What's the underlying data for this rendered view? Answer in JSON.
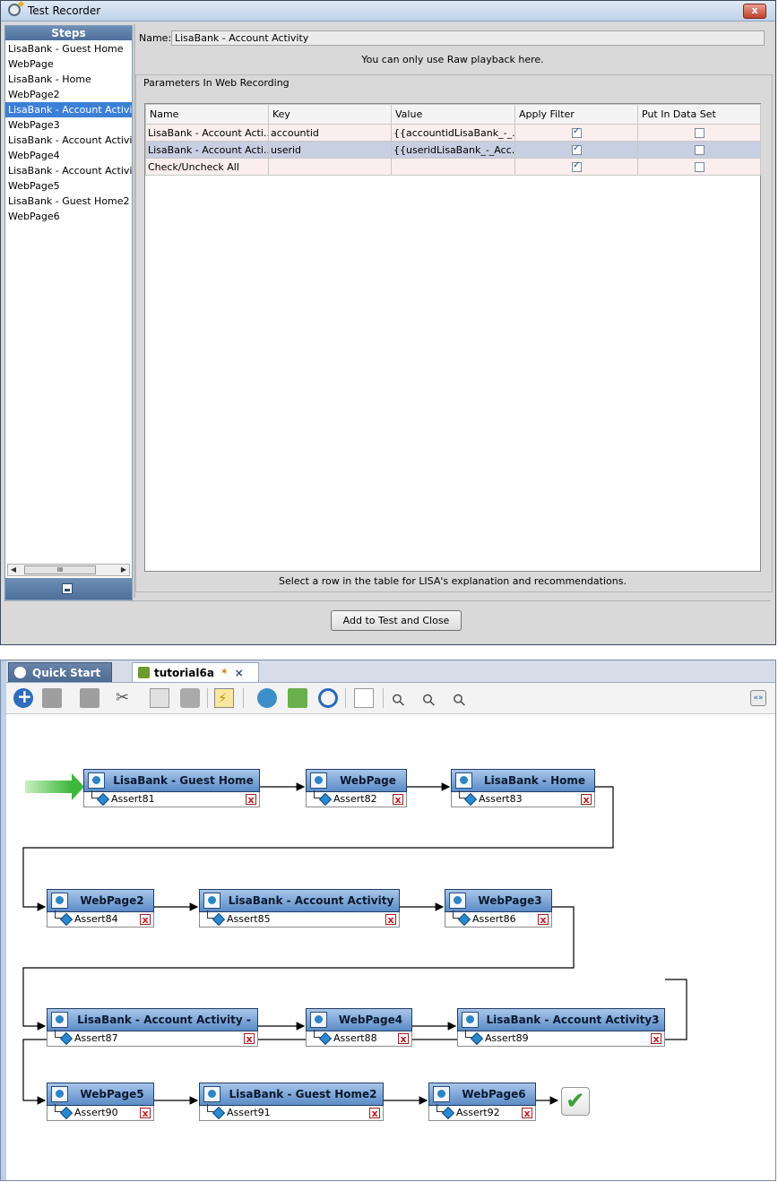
{
  "recorder": {
    "title": "Test Recorder",
    "steps_header": "Steps",
    "steps": [
      "LisaBank - Guest Home",
      "WebPage",
      "LisaBank - Home",
      "WebPage2",
      "LisaBank - Account Activity",
      "WebPage3",
      "LisaBank - Account Activity",
      "WebPage4",
      "LisaBank - Account Activity",
      "WebPage5",
      "LisaBank - Guest Home2",
      "WebPage6"
    ],
    "selected_step_index": 4,
    "name_label": "Name:",
    "name_value": "LisaBank - Account Activity",
    "raw_note": "You can only use Raw playback here.",
    "params_group_title": "Parameters In Web Recording",
    "table": {
      "columns": [
        "Name",
        "Key",
        "Value",
        "Apply Filter",
        "Put In Data Set"
      ],
      "rows": [
        {
          "name": "LisaBank - Account Acti...",
          "key": "accountid",
          "value": "{{accountidLisaBank_-_...",
          "apply_filter": true,
          "put_in_data_set": false
        },
        {
          "name": "LisaBank - Account Acti...",
          "key": "userid",
          "value": "{{useridLisaBank_-_Acc...",
          "apply_filter": true,
          "put_in_data_set": false
        },
        {
          "name": "Check/Uncheck All",
          "key": "",
          "value": "",
          "apply_filter": true,
          "put_in_data_set": false
        }
      ]
    },
    "explanation": "Select a row in the table for LISA's explanation and recommendations.",
    "add_button": "Add to Test and Close",
    "scroll_thumb_label": "III"
  },
  "editor": {
    "tabs": [
      {
        "label": "Quick Start"
      },
      {
        "label": "tutorial6a",
        "modified_marker": "*",
        "close": "×"
      }
    ],
    "toolbar_icons": [
      "add-step-icon",
      "stop-icon",
      "back-icon",
      "cut-icon",
      "copy-icon",
      "paste-icon",
      "lightning-icon",
      "gear-icon",
      "export-icon",
      "cycle-icon",
      "checklist-icon",
      "zoom-icon",
      "zoom-in-icon",
      "zoom-out-icon"
    ],
    "expand_label": "«»",
    "nodes": [
      {
        "label": "LisaBank - Guest Home",
        "assert": "Assert81"
      },
      {
        "label": "WebPage",
        "assert": "Assert82"
      },
      {
        "label": "LisaBank - Home",
        "assert": "Assert83"
      },
      {
        "label": "WebPage2",
        "assert": "Assert84"
      },
      {
        "label": "LisaBank - Account Activity",
        "assert": "Assert85"
      },
      {
        "label": "WebPage3",
        "assert": "Assert86"
      },
      {
        "label": "LisaBank - Account Activity -",
        "assert": "Assert87"
      },
      {
        "label": "WebPage4",
        "assert": "Assert88"
      },
      {
        "label": "LisaBank - Account Activity3",
        "assert": "Assert89"
      },
      {
        "label": "WebPage5",
        "assert": "Assert90"
      },
      {
        "label": "LisaBank - Guest Home2",
        "assert": "Assert91"
      },
      {
        "label": "WebPage6",
        "assert": "Assert92"
      }
    ],
    "delete_glyph": "x"
  }
}
